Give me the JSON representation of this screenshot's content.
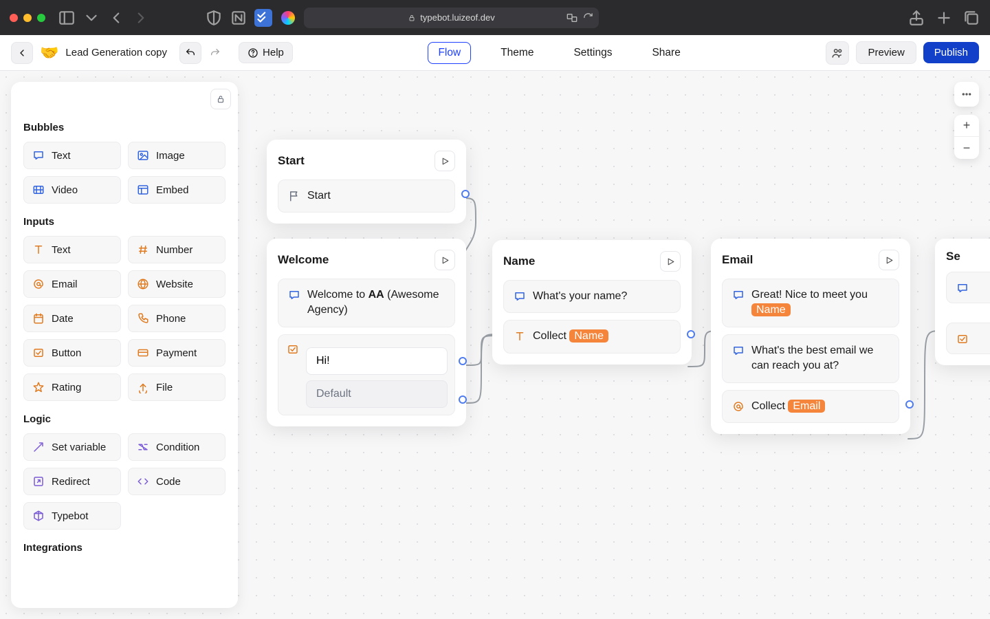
{
  "browser": {
    "url": "typebot.luizeof.dev"
  },
  "header": {
    "botName": "Lead Generation copy",
    "botEmoji": "🤝",
    "help": "Help",
    "tabs": {
      "flow": "Flow",
      "theme": "Theme",
      "settings": "Settings",
      "share": "Share"
    },
    "preview": "Preview",
    "publish": "Publish"
  },
  "sidebar": {
    "sections": {
      "bubbles": "Bubbles",
      "inputs": "Inputs",
      "logic": "Logic",
      "integrations": "Integrations"
    },
    "bubbles": {
      "text": "Text",
      "image": "Image",
      "video": "Video",
      "embed": "Embed"
    },
    "inputs": {
      "text": "Text",
      "number": "Number",
      "email": "Email",
      "website": "Website",
      "date": "Date",
      "phone": "Phone",
      "button": "Button",
      "payment": "Payment",
      "rating": "Rating",
      "file": "File"
    },
    "logic": {
      "setvar": "Set variable",
      "condition": "Condition",
      "redirect": "Redirect",
      "code": "Code",
      "typebot": "Typebot"
    }
  },
  "nodes": {
    "start": {
      "title": "Start",
      "block": "Start"
    },
    "welcome": {
      "title": "Welcome",
      "line_prefix": "Welcome to ",
      "line_bold": "AA",
      "line_suffix": " (Awesome Agency)",
      "hi": "Hi!",
      "default": "Default"
    },
    "name": {
      "title": "Name",
      "q": "What's your name?",
      "collect": "Collect ",
      "var": "Name"
    },
    "email": {
      "title": "Email",
      "greet": "Great! Nice to meet you ",
      "greet_var": "Name",
      "q": "What's the best email we can reach you at?",
      "collect": "Collect ",
      "var": "Email"
    },
    "services": {
      "title_partial": "Se"
    }
  }
}
